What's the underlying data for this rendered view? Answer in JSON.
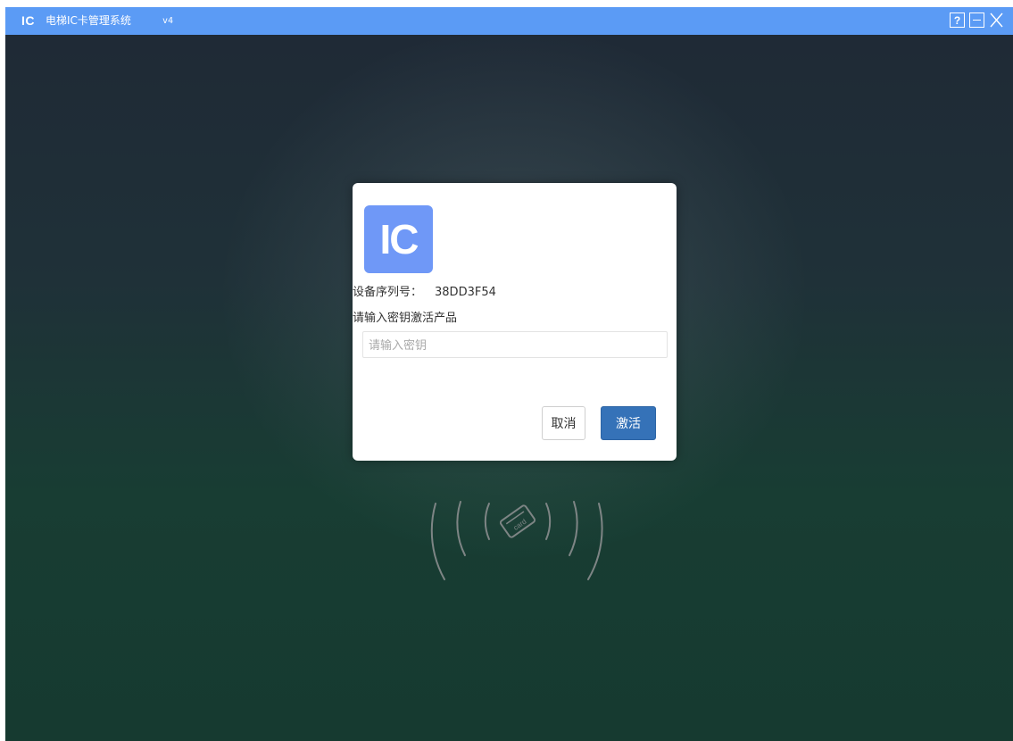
{
  "titlebar": {
    "logo": "IC",
    "title": "电梯IC卡管理系统",
    "version": "v4",
    "help_icon": "question-icon",
    "minimize_icon": "minimize-icon",
    "close_icon": "close-icon"
  },
  "background": {
    "graphic_icon": "card-reader-icon",
    "graphic_text": "card"
  },
  "dialog": {
    "logo_text": "IC",
    "serial_label": "设备序列号：",
    "serial_value": "38DD3F54",
    "prompt": "请输入密钥激活产品",
    "key_input": {
      "value": "",
      "placeholder": "请输入密钥"
    },
    "cancel_label": "取消",
    "activate_label": "激活"
  },
  "colors": {
    "titlebar": "#5b9bf5",
    "logo_tile": "#6f98f7",
    "primary_button": "#3572b8",
    "background_top": "#1f2a36",
    "background_bottom": "#163a30"
  }
}
